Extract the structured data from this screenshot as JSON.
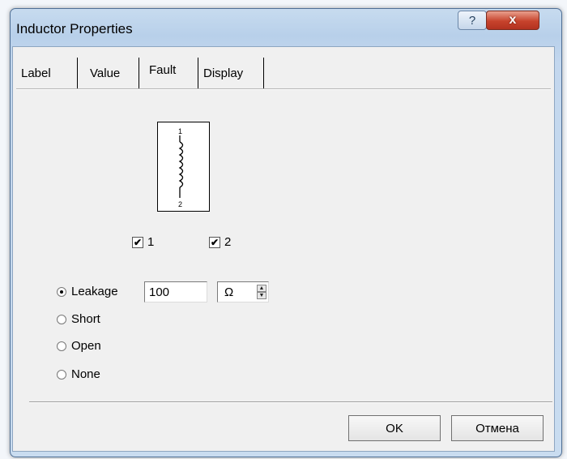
{
  "window": {
    "title": "Inductor Properties",
    "help_label": "?",
    "close_label": "x"
  },
  "tabs": [
    {
      "label": "Label",
      "active": false
    },
    {
      "label": "Value",
      "active": false
    },
    {
      "label": "Fault",
      "active": true
    },
    {
      "label": "Display",
      "active": false
    }
  ],
  "symbol": {
    "pin_top": "1",
    "pin_bottom": "2"
  },
  "pins": [
    {
      "label": "1",
      "checked": true
    },
    {
      "label": "2",
      "checked": true
    }
  ],
  "fault_options": [
    {
      "label": "Leakage",
      "selected": true
    },
    {
      "label": "Short",
      "selected": false
    },
    {
      "label": "Open",
      "selected": false
    },
    {
      "label": "None",
      "selected": false
    }
  ],
  "leakage": {
    "value": "100",
    "unit": "Ω"
  },
  "buttons": {
    "ok": "OK",
    "cancel": "Отмена"
  }
}
